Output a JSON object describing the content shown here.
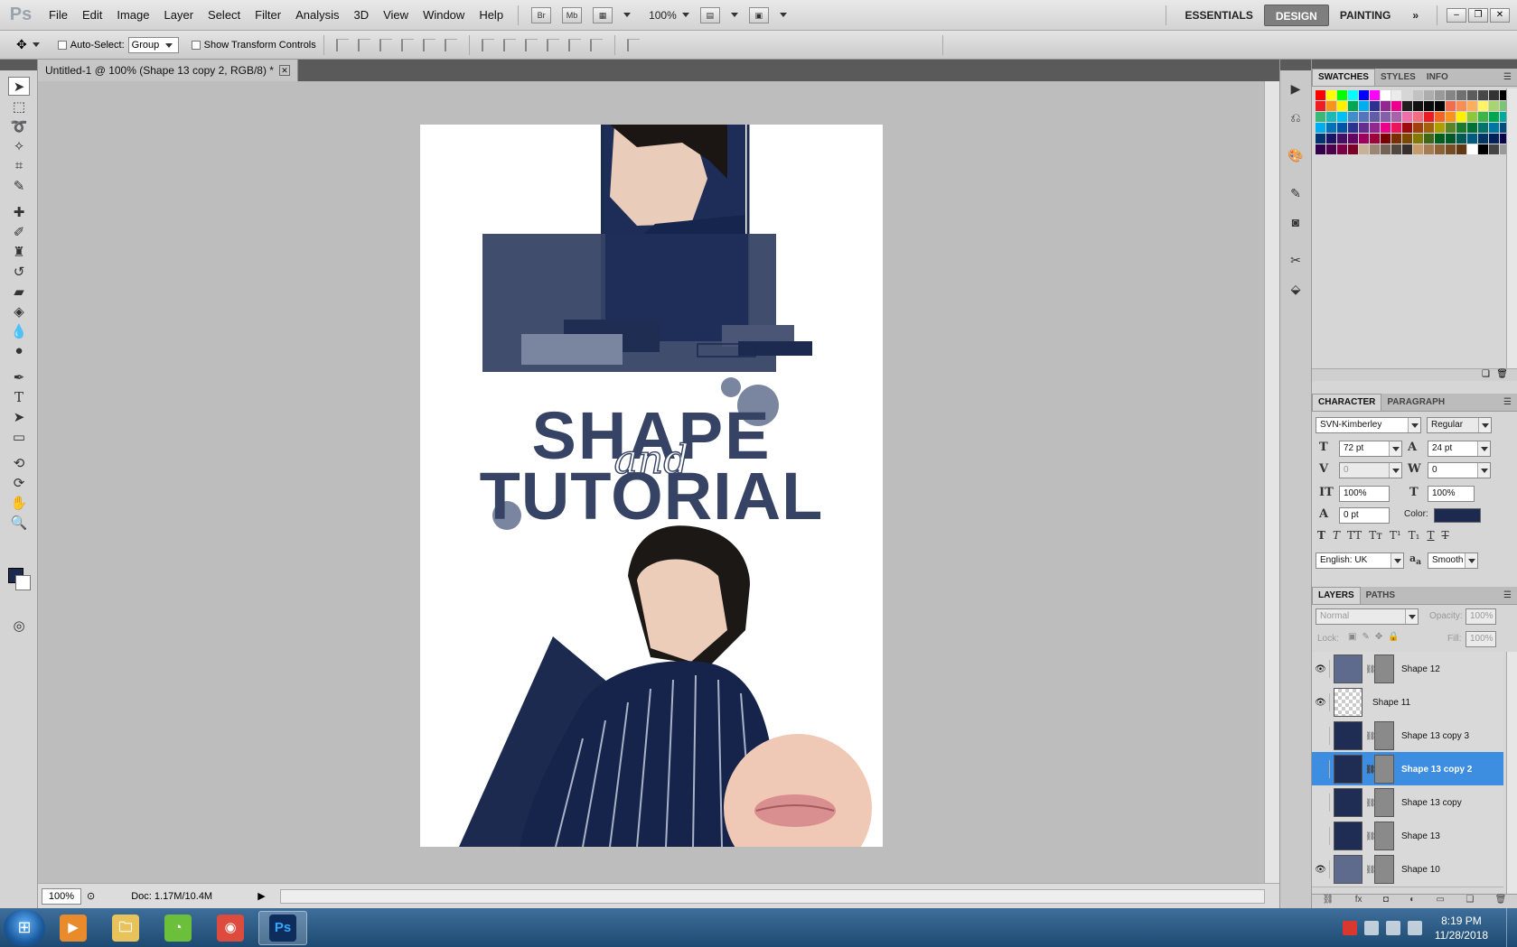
{
  "menubar": {
    "logo": "Ps",
    "items": [
      "File",
      "Edit",
      "Image",
      "Layer",
      "Select",
      "Filter",
      "Analysis",
      "3D",
      "View",
      "Window",
      "Help"
    ],
    "bridge_label": "Br",
    "minibridge_label": "Mb",
    "zoom": "100%",
    "workspaces": [
      "ESSENTIALS",
      "DESIGN",
      "PAINTING"
    ],
    "active_workspace": "DESIGN",
    "more_label": "»"
  },
  "options": {
    "auto_select_label": "Auto-Select:",
    "auto_select_value": "Group",
    "transform_label": "Show Transform Controls"
  },
  "document": {
    "tab_title": "Untitled-1 @ 100% (Shape 13 copy 2, RGB/8) *",
    "status_zoom": "100%",
    "status_doc": "Doc: 1.17M/10.4M"
  },
  "artwork": {
    "title_line1": "SHAPE",
    "title_script": "and",
    "title_line2": "TUTORIAL",
    "colors": {
      "navy": "#1b2a4e",
      "slate": "#374364",
      "light_slate": "#7a869f"
    }
  },
  "swatches_panel": {
    "tabs": [
      "SWATCHES",
      "STYLES",
      "INFO"
    ],
    "active": "SWATCHES"
  },
  "character": {
    "tabs": [
      "CHARACTER",
      "PARAGRAPH"
    ],
    "font_family": "SVN-Kimberley",
    "font_style": "Regular",
    "font_size": "72 pt",
    "leading": "24 pt",
    "kerning": "0",
    "tracking": "0",
    "vertical_scale": "100%",
    "horizontal_scale": "100%",
    "baseline_shift": "0 pt",
    "color_label": "Color:",
    "language": "English: UK",
    "aa_label": "a",
    "antialias": "Smooth",
    "text_color": "#1b2a4e"
  },
  "layers": {
    "tabs": [
      "LAYERS",
      "PATHS"
    ],
    "blend_mode": "Normal",
    "opacity_label": "Opacity:",
    "opacity": "100%",
    "lock_label": "Lock:",
    "fill_label": "Fill:",
    "fill": "100%",
    "items": [
      {
        "name": "Shape 12",
        "visible": true,
        "thumb": "slate",
        "has_mask": true,
        "selected": false
      },
      {
        "name": "Shape 11",
        "visible": true,
        "thumb": "checker",
        "has_mask": false,
        "selected": false
      },
      {
        "name": "Shape 13 copy 3",
        "visible": false,
        "thumb": "navy",
        "has_mask": true,
        "selected": false
      },
      {
        "name": "Shape 13 copy 2",
        "visible": false,
        "thumb": "navy",
        "has_mask": true,
        "selected": true
      },
      {
        "name": "Shape 13 copy",
        "visible": false,
        "thumb": "navy",
        "has_mask": true,
        "selected": false
      },
      {
        "name": "Shape 13",
        "visible": false,
        "thumb": "navy",
        "has_mask": true,
        "selected": false
      },
      {
        "name": "Shape 10",
        "visible": true,
        "thumb": "slate",
        "has_mask": true,
        "selected": false
      }
    ]
  },
  "taskbar": {
    "apps": [
      "Media",
      "Explorer",
      "Greenshot",
      "Chrome",
      "Ps"
    ],
    "active_app": "Ps",
    "time": "8:19 PM",
    "date": "11/28/2018"
  }
}
